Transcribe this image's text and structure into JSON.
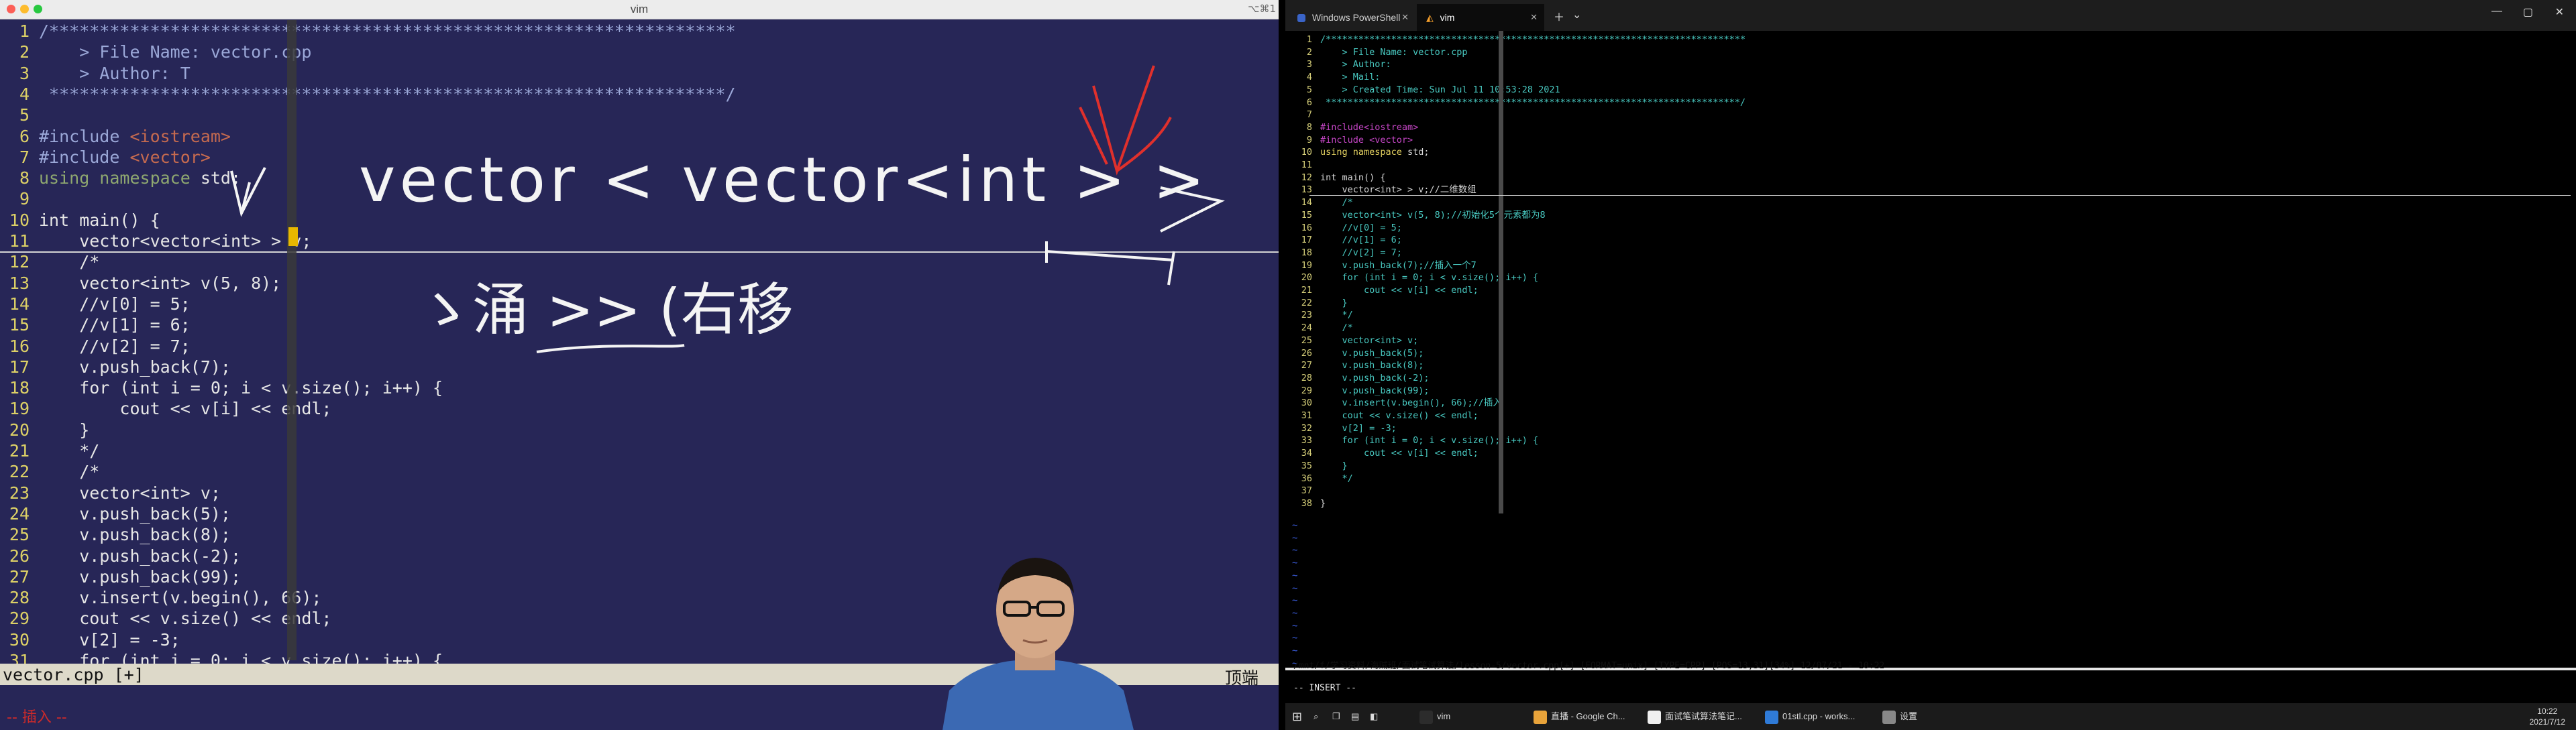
{
  "left_window": {
    "title": "vim",
    "corner_label": "⌥⌘1",
    "lines": [
      {
        "n": "1",
        "parts": [
          {
            "t": "/********************************************************************",
            "c": "kw-pre"
          }
        ]
      },
      {
        "n": "2",
        "parts": [
          {
            "t": "    > File Name: vector.cpp",
            "c": "kw-pre"
          }
        ]
      },
      {
        "n": "3",
        "parts": [
          {
            "t": "    > Author: T",
            "c": "kw-pre"
          }
        ]
      },
      {
        "n": "4",
        "parts": [
          {
            "t": " *******************************************************************/",
            "c": "kw-pre"
          }
        ]
      },
      {
        "n": "5",
        "parts": [
          {
            "t": "",
            "c": ""
          }
        ]
      },
      {
        "n": "6",
        "parts": [
          {
            "t": "#include ",
            "c": "kw-pre"
          },
          {
            "t": "<iostream>",
            "c": "kw-inc"
          }
        ]
      },
      {
        "n": "7",
        "parts": [
          {
            "t": "#include ",
            "c": "kw-pre"
          },
          {
            "t": "<vector>",
            "c": "kw-inc"
          }
        ]
      },
      {
        "n": "8",
        "parts": [
          {
            "t": "using namespace ",
            "c": "kw-typ"
          },
          {
            "t": "std;",
            "c": ""
          }
        ]
      },
      {
        "n": "9",
        "parts": [
          {
            "t": "",
            "c": ""
          }
        ]
      },
      {
        "n": "10",
        "parts": [
          {
            "t": "int main() {",
            "c": ""
          }
        ]
      },
      {
        "n": "11",
        "parts": [
          {
            "t": "    vector<vector<int> > v;",
            "c": ""
          }
        ]
      },
      {
        "n": "12",
        "parts": [
          {
            "t": "    /*",
            "c": ""
          }
        ]
      },
      {
        "n": "13",
        "parts": [
          {
            "t": "    vector<int> v(5, 8);",
            "c": ""
          }
        ]
      },
      {
        "n": "14",
        "parts": [
          {
            "t": "    //v[0] = 5;",
            "c": ""
          }
        ]
      },
      {
        "n": "15",
        "parts": [
          {
            "t": "    //v[1] = 6;",
            "c": ""
          }
        ]
      },
      {
        "n": "16",
        "parts": [
          {
            "t": "    //v[2] = 7;",
            "c": ""
          }
        ]
      },
      {
        "n": "17",
        "parts": [
          {
            "t": "    v.push_back(7);",
            "c": ""
          }
        ]
      },
      {
        "n": "18",
        "parts": [
          {
            "t": "    for (int i = 0; i < v.size(); i++) {",
            "c": ""
          }
        ]
      },
      {
        "n": "19",
        "parts": [
          {
            "t": "        cout << v[i] << endl;",
            "c": ""
          }
        ]
      },
      {
        "n": "20",
        "parts": [
          {
            "t": "    }",
            "c": ""
          }
        ]
      },
      {
        "n": "21",
        "parts": [
          {
            "t": "    */",
            "c": ""
          }
        ]
      },
      {
        "n": "22",
        "parts": [
          {
            "t": "    /*",
            "c": ""
          }
        ]
      },
      {
        "n": "23",
        "parts": [
          {
            "t": "    vector<int> v;",
            "c": ""
          }
        ]
      },
      {
        "n": "24",
        "parts": [
          {
            "t": "    v.push_back(5);",
            "c": ""
          }
        ]
      },
      {
        "n": "25",
        "parts": [
          {
            "t": "    v.push_back(8);",
            "c": ""
          }
        ]
      },
      {
        "n": "26",
        "parts": [
          {
            "t": "    v.push_back(-2);",
            "c": ""
          }
        ]
      },
      {
        "n": "27",
        "parts": [
          {
            "t": "    v.push_back(99);",
            "c": ""
          }
        ]
      },
      {
        "n": "28",
        "parts": [
          {
            "t": "    v.insert(v.begin(), 66);",
            "c": ""
          }
        ]
      },
      {
        "n": "29",
        "parts": [
          {
            "t": "    cout << v.size() << endl;",
            "c": ""
          }
        ]
      },
      {
        "n": "30",
        "parts": [
          {
            "t": "    v[2] = -3;",
            "c": ""
          }
        ]
      },
      {
        "n": "31",
        "parts": [
          {
            "t": "    for (int i = 0; i < v.size(); i++) {",
            "c": ""
          }
        ]
      }
    ],
    "status_file": "vector.cpp [+]",
    "status_pos": "顶端",
    "mode": "-- 插入 --",
    "handwriting": {
      "line1": "vector < vector<int >  >",
      "line2": "ゝ涌  >>  (右移"
    }
  },
  "right_window": {
    "tabs": [
      {
        "label": "Windows PowerShell"
      },
      {
        "label": "vim"
      }
    ],
    "lines": [
      {
        "n": "1",
        "parts": [
          {
            "t": "/*****************************************************************************",
            "c": "rc-cyan"
          }
        ]
      },
      {
        "n": "2",
        "parts": [
          {
            "t": "    > File Name: vector.cpp",
            "c": "rc-cyan"
          }
        ]
      },
      {
        "n": "3",
        "parts": [
          {
            "t": "    > Author:",
            "c": "rc-cyan"
          }
        ]
      },
      {
        "n": "4",
        "parts": [
          {
            "t": "    > Mail:",
            "c": "rc-cyan"
          }
        ]
      },
      {
        "n": "5",
        "parts": [
          {
            "t": "    > Created Time: Sun Jul 11 10:53:28 2021",
            "c": "rc-cyan"
          }
        ]
      },
      {
        "n": "6",
        "parts": [
          {
            "t": " ****************************************************************************/",
            "c": "rc-cyan"
          }
        ]
      },
      {
        "n": "7",
        "parts": [
          {
            "t": "",
            "c": ""
          }
        ]
      },
      {
        "n": "8",
        "parts": [
          {
            "t": "#include",
            "c": "rc-mag"
          },
          {
            "t": "<iostream>",
            "c": "rc-mag"
          }
        ]
      },
      {
        "n": "9",
        "parts": [
          {
            "t": "#include ",
            "c": "rc-mag"
          },
          {
            "t": "<vector>",
            "c": "rc-mag"
          }
        ]
      },
      {
        "n": "10",
        "parts": [
          {
            "t": "using namespace ",
            "c": "rc-yel"
          },
          {
            "t": "std;",
            "c": ""
          }
        ]
      },
      {
        "n": "11",
        "parts": [
          {
            "t": "",
            "c": ""
          }
        ]
      },
      {
        "n": "12",
        "parts": [
          {
            "t": "int main() {",
            "c": ""
          }
        ]
      },
      {
        "n": "13",
        "parts": [
          {
            "t": "    vector<int> > v;//二维数组",
            "c": ""
          }
        ]
      },
      {
        "n": "14",
        "parts": [
          {
            "t": "    /*",
            "c": "rc-cyan"
          }
        ]
      },
      {
        "n": "15",
        "parts": [
          {
            "t": "    vector<int> v(5, 8);//初始化5个元素都为8",
            "c": "rc-cyan"
          }
        ]
      },
      {
        "n": "16",
        "parts": [
          {
            "t": "    //v[0] = 5;",
            "c": "rc-cyan"
          }
        ]
      },
      {
        "n": "17",
        "parts": [
          {
            "t": "    //v[1] = 6;",
            "c": "rc-cyan"
          }
        ]
      },
      {
        "n": "18",
        "parts": [
          {
            "t": "    //v[2] = 7;",
            "c": "rc-cyan"
          }
        ]
      },
      {
        "n": "19",
        "parts": [
          {
            "t": "    v.push_back(7);//插入一个7",
            "c": "rc-cyan"
          }
        ]
      },
      {
        "n": "20",
        "parts": [
          {
            "t": "    for (int i = 0; i < v.size(); i++) {",
            "c": "rc-cyan"
          }
        ]
      },
      {
        "n": "21",
        "parts": [
          {
            "t": "        cout << v[i] << endl;",
            "c": "rc-cyan"
          }
        ]
      },
      {
        "n": "22",
        "parts": [
          {
            "t": "    }",
            "c": "rc-cyan"
          }
        ]
      },
      {
        "n": "23",
        "parts": [
          {
            "t": "    */",
            "c": "rc-cyan"
          }
        ]
      },
      {
        "n": "24",
        "parts": [
          {
            "t": "    /*",
            "c": "rc-cyan"
          }
        ]
      },
      {
        "n": "25",
        "parts": [
          {
            "t": "    vector<int> v;",
            "c": "rc-cyan"
          }
        ]
      },
      {
        "n": "26",
        "parts": [
          {
            "t": "    v.push_back(5);",
            "c": "rc-cyan"
          }
        ]
      },
      {
        "n": "27",
        "parts": [
          {
            "t": "    v.push_back(8);",
            "c": "rc-cyan"
          }
        ]
      },
      {
        "n": "28",
        "parts": [
          {
            "t": "    v.push_back(-2);",
            "c": "rc-cyan"
          }
        ]
      },
      {
        "n": "29",
        "parts": [
          {
            "t": "    v.push_back(99);",
            "c": "rc-cyan"
          }
        ]
      },
      {
        "n": "30",
        "parts": [
          {
            "t": "    v.insert(v.begin(), 66);//插入",
            "c": "rc-cyan"
          }
        ]
      },
      {
        "n": "31",
        "parts": [
          {
            "t": "    cout << v.size() << endl;",
            "c": "rc-cyan"
          }
        ]
      },
      {
        "n": "32",
        "parts": [
          {
            "t": "    v[2] = -3;",
            "c": "rc-cyan"
          }
        ]
      },
      {
        "n": "33",
        "parts": [
          {
            "t": "    for (int i = 0; i < v.size(); i++) {",
            "c": "rc-cyan"
          }
        ]
      },
      {
        "n": "34",
        "parts": [
          {
            "t": "        cout << v[i] << endl;",
            "c": "rc-cyan"
          }
        ]
      },
      {
        "n": "35",
        "parts": [
          {
            "t": "    }",
            "c": "rc-cyan"
          }
        ]
      },
      {
        "n": "36",
        "parts": [
          {
            "t": "    */",
            "c": "rc-cyan"
          }
        ]
      },
      {
        "n": "37",
        "parts": [
          {
            "t": "",
            "c": ""
          }
        ]
      },
      {
        "n": "38",
        "parts": [
          {
            "t": "}",
            "c": ""
          }
        ]
      }
    ],
    "tilde": "~",
    "status": "/mnt/f/学习资料/海贼班/面试笔试算法/lesson-5/vector.cpp[+] [FORMAT=unix] [TYPE=CPP] [POS=13,31][34%] 12/07/21 - 10:22",
    "mode": "-- INSERT --",
    "taskbar": {
      "items": [
        {
          "label": "vim",
          "color": "#2c2c2c"
        },
        {
          "label": "直播 - Google Ch...",
          "color": "#e8a33a"
        },
        {
          "label": "面试笔试算法笔记...",
          "color": "#f0f0f0"
        },
        {
          "label": "01stl.cpp - works...",
          "color": "#2f7bd8"
        },
        {
          "label": "设置",
          "color": "#888888"
        }
      ],
      "time": "10:22",
      "date": "2021/7/12"
    }
  }
}
